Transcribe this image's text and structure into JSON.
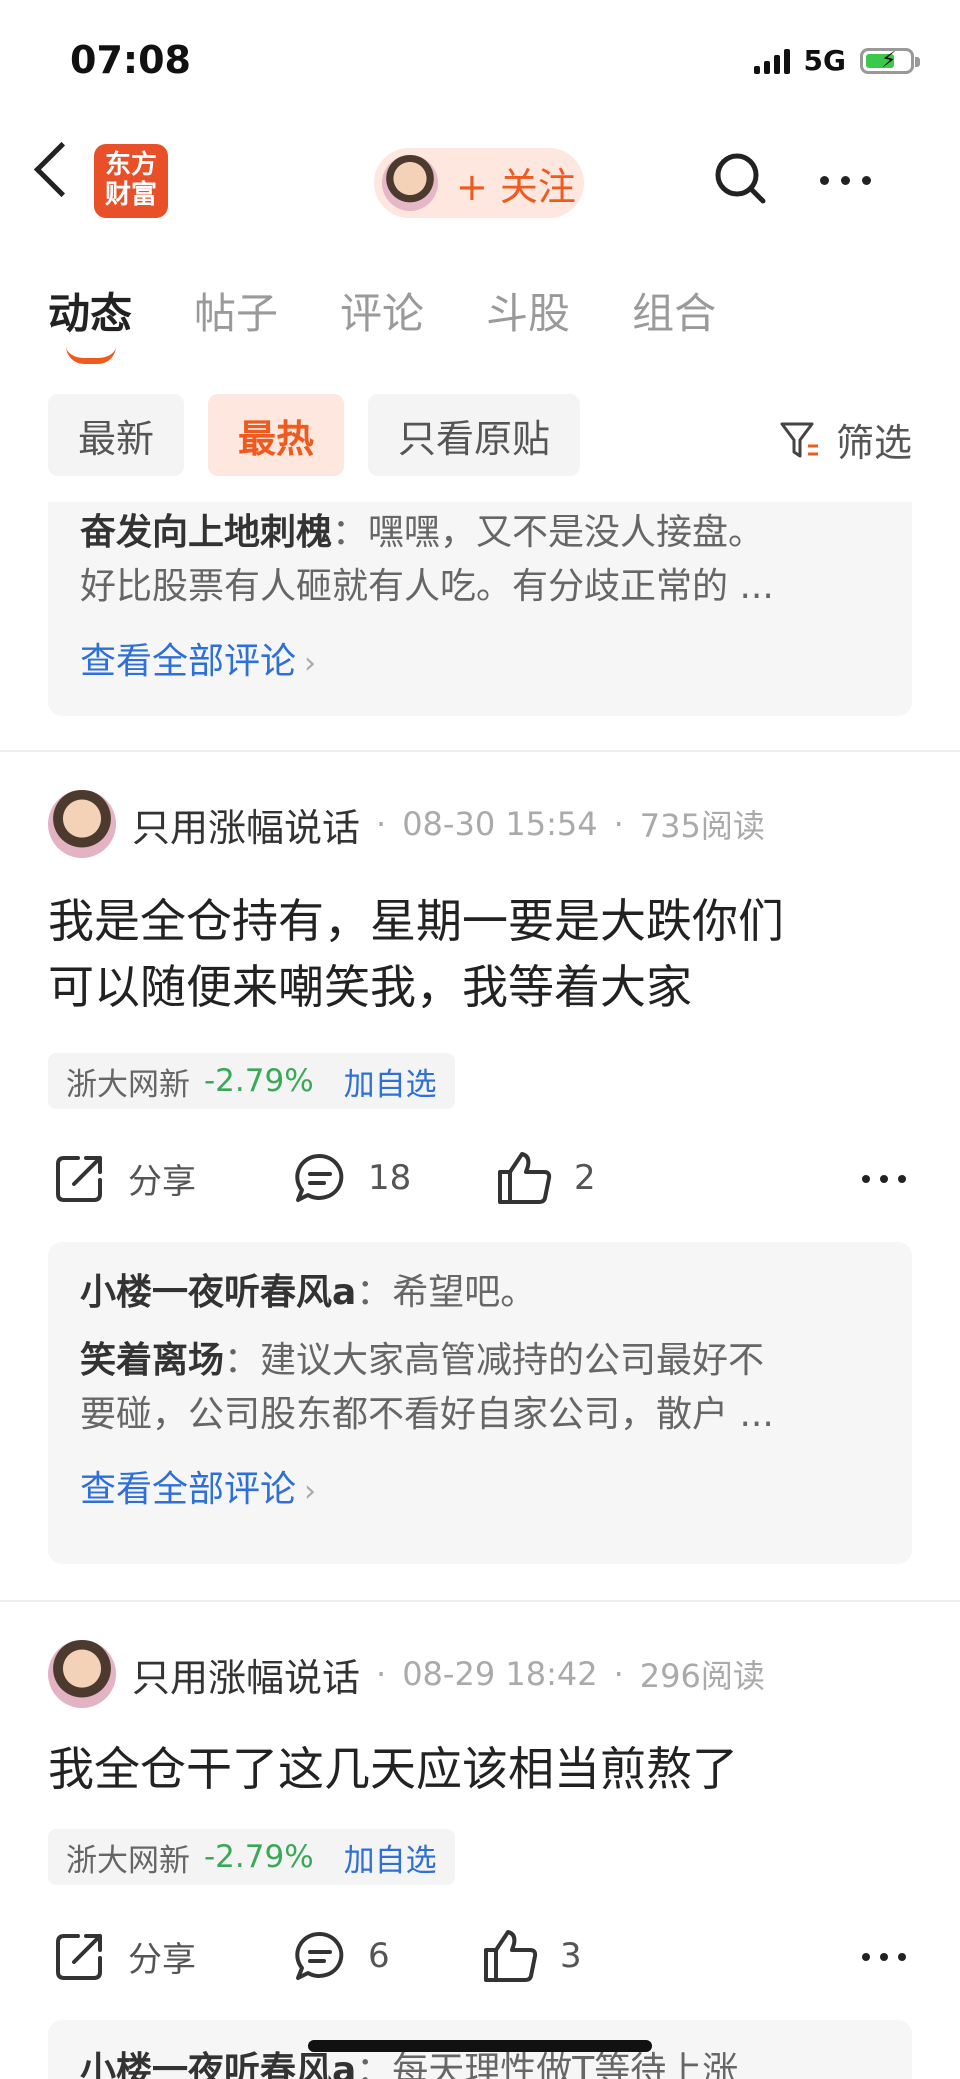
{
  "status_bar": {
    "time": "07:08",
    "network": "5G"
  },
  "nav": {
    "logo_line1": "东方",
    "logo_line2": "财富",
    "follow_label": "+ 关注"
  },
  "tabs": [
    {
      "label": "动态",
      "active": true
    },
    {
      "label": "帖子",
      "active": false
    },
    {
      "label": "评论",
      "active": false
    },
    {
      "label": "斗股",
      "active": false
    },
    {
      "label": "组合",
      "active": false
    }
  ],
  "filters": {
    "chips": [
      {
        "label": "最新",
        "active": false
      },
      {
        "label": "最热",
        "active": true
      },
      {
        "label": "只看原贴",
        "active": false
      }
    ],
    "filter_label": "筛选"
  },
  "top_comments": {
    "line1_user": "奋发向上地刺槐",
    "line1_text": "：嘿嘿，又不是没人接盘。",
    "line2_text": "好比股票有人砸就有人吃。有分歧正常的 ...",
    "view_all": "查看全部评论"
  },
  "posts": [
    {
      "author": "只用涨幅说话",
      "date": "08-30 15:54",
      "reads": "735阅读",
      "text_line1": "我是全仓持有，星期一要是大跌你们",
      "text_line2": "可以随便来嘲笑我，我等着大家",
      "stock": {
        "name": "浙大网新",
        "change": "-2.79%",
        "add": "加自选"
      },
      "share": "分享",
      "comments": "18",
      "likes": "2",
      "replies": [
        {
          "user": "小楼一夜听春风a",
          "text": "：希望吧。"
        },
        {
          "user": "笑着离场",
          "text": "：建议大家高管减持的公司最好不",
          "text2": "要碰，公司股东都不看好自家公司，散户 ..."
        }
      ],
      "view_all": "查看全部评论"
    },
    {
      "author": "只用涨幅说话",
      "date": "08-29 18:42",
      "reads": "296阅读",
      "text_line1": "我全仓干了这几天应该相当煎熬了",
      "stock": {
        "name": "浙大网新",
        "change": "-2.79%",
        "add": "加自选"
      },
      "share": "分享",
      "comments": "6",
      "likes": "3",
      "reply_partial": {
        "user": "小楼一夜听春风a",
        "text": "：每天理性做T等待上涨"
      }
    }
  ],
  "colors": {
    "accent": "#ef5a1f",
    "link": "#2f6fd8",
    "down": "#3aa856"
  }
}
